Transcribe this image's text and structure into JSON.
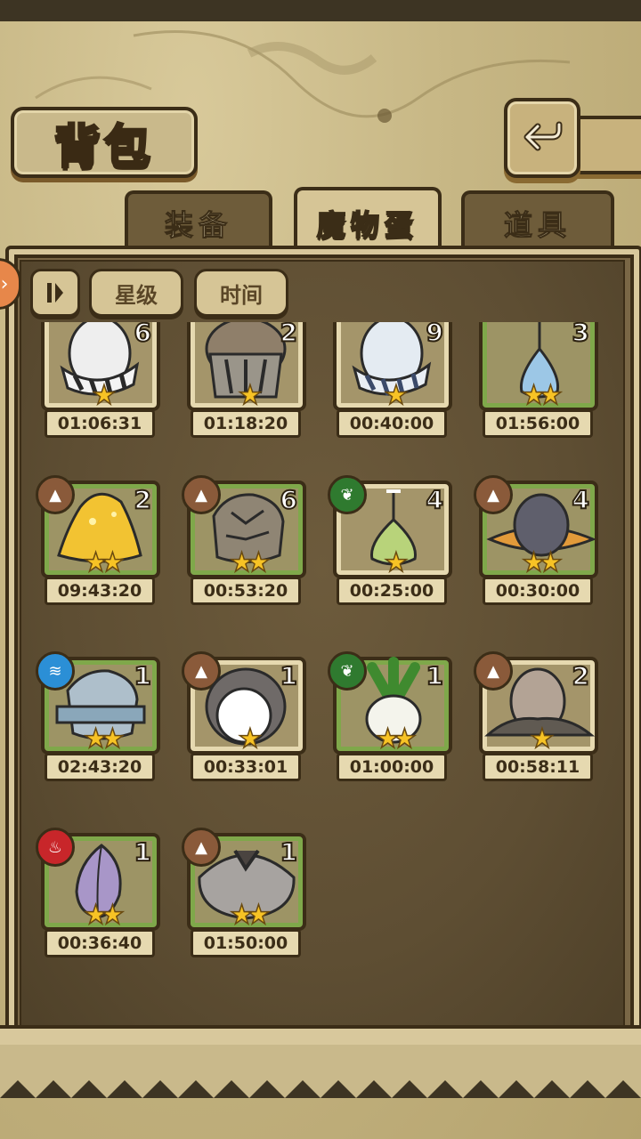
{
  "header": {
    "title": "背包"
  },
  "tabs": [
    {
      "label": "装备",
      "active": false
    },
    {
      "label": "魔物蛋",
      "active": true
    },
    {
      "label": "道具",
      "active": false
    }
  ],
  "sort": {
    "buttons": [
      "星级",
      "时间"
    ]
  },
  "colors": {
    "element_earth": "#8a5a3a",
    "element_water": "#2b8fd6",
    "element_grass": "#2f7a2f",
    "element_fire": "#c8262a",
    "star": "#f7c325"
  },
  "eggs": [
    {
      "count": "6",
      "stars": "★",
      "timer": "01:06:31",
      "element": "earth"
    },
    {
      "count": "2",
      "stars": "★",
      "timer": "01:18:20",
      "element": "earth"
    },
    {
      "count": "9",
      "stars": "★",
      "timer": "00:40:00",
      "element": "water"
    },
    {
      "count": "3",
      "stars": "★★",
      "timer": "01:56:00",
      "element": "water"
    },
    {
      "count": "2",
      "stars": "★★",
      "timer": "09:43:20",
      "element": "earth"
    },
    {
      "count": "6",
      "stars": "★★",
      "timer": "00:53:20",
      "element": "earth"
    },
    {
      "count": "4",
      "stars": "★",
      "timer": "00:25:00",
      "element": "grass"
    },
    {
      "count": "4",
      "stars": "★★",
      "timer": "00:30:00",
      "element": "earth"
    },
    {
      "count": "1",
      "stars": "★★",
      "timer": "02:43:20",
      "element": "water"
    },
    {
      "count": "1",
      "stars": "★",
      "timer": "00:33:01",
      "element": "earth"
    },
    {
      "count": "1",
      "stars": "★★",
      "timer": "01:00:00",
      "element": "grass"
    },
    {
      "count": "2",
      "stars": "★",
      "timer": "00:58:11",
      "element": "earth"
    },
    {
      "count": "1",
      "stars": "★★",
      "timer": "00:36:40",
      "element": "fire"
    },
    {
      "count": "1",
      "stars": "★★",
      "timer": "01:50:00",
      "element": "earth"
    }
  ]
}
